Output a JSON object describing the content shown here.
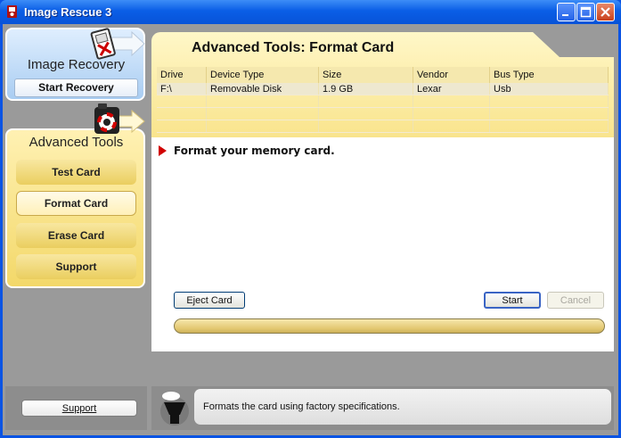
{
  "window": {
    "title": "Image Rescue 3",
    "icon": "app-logo-icon",
    "controls": [
      "minimize-icon",
      "maximize-icon",
      "close-icon"
    ]
  },
  "sidebar": {
    "recovery": {
      "title": "Image Recovery",
      "button": "Start Recovery",
      "icon": "memory-card-x-icon"
    },
    "advanced": {
      "title": "Advanced Tools",
      "icon": "camera-lifebuoy-icon",
      "items": [
        "Test Card",
        "Format Card",
        "Erase Card",
        "Support"
      ],
      "active_index": 1
    },
    "support_button": "Support"
  },
  "main": {
    "title": "Advanced Tools: Format Card",
    "table": {
      "columns": [
        "Drive",
        "Device Type",
        "Size",
        "Vendor",
        "Bus Type"
      ],
      "rows": [
        [
          "F:\\",
          "Removable Disk",
          "1.9 GB",
          "Lexar",
          "Usb"
        ]
      ]
    },
    "instruction": "Format your memory card.",
    "buttons": {
      "eject": "Eject Card",
      "start": "Start",
      "cancel": "Cancel"
    },
    "progress_fraction": 0
  },
  "footer": {
    "icon": "assistant-figure-icon",
    "info_text": "Formats the card using factory specifications."
  },
  "colors": {
    "titlebar": "#0a5ee6",
    "recovery_panel": "#a9cdf2",
    "advanced_panel": "#f3d869",
    "accent_arrow": "#d10000"
  }
}
